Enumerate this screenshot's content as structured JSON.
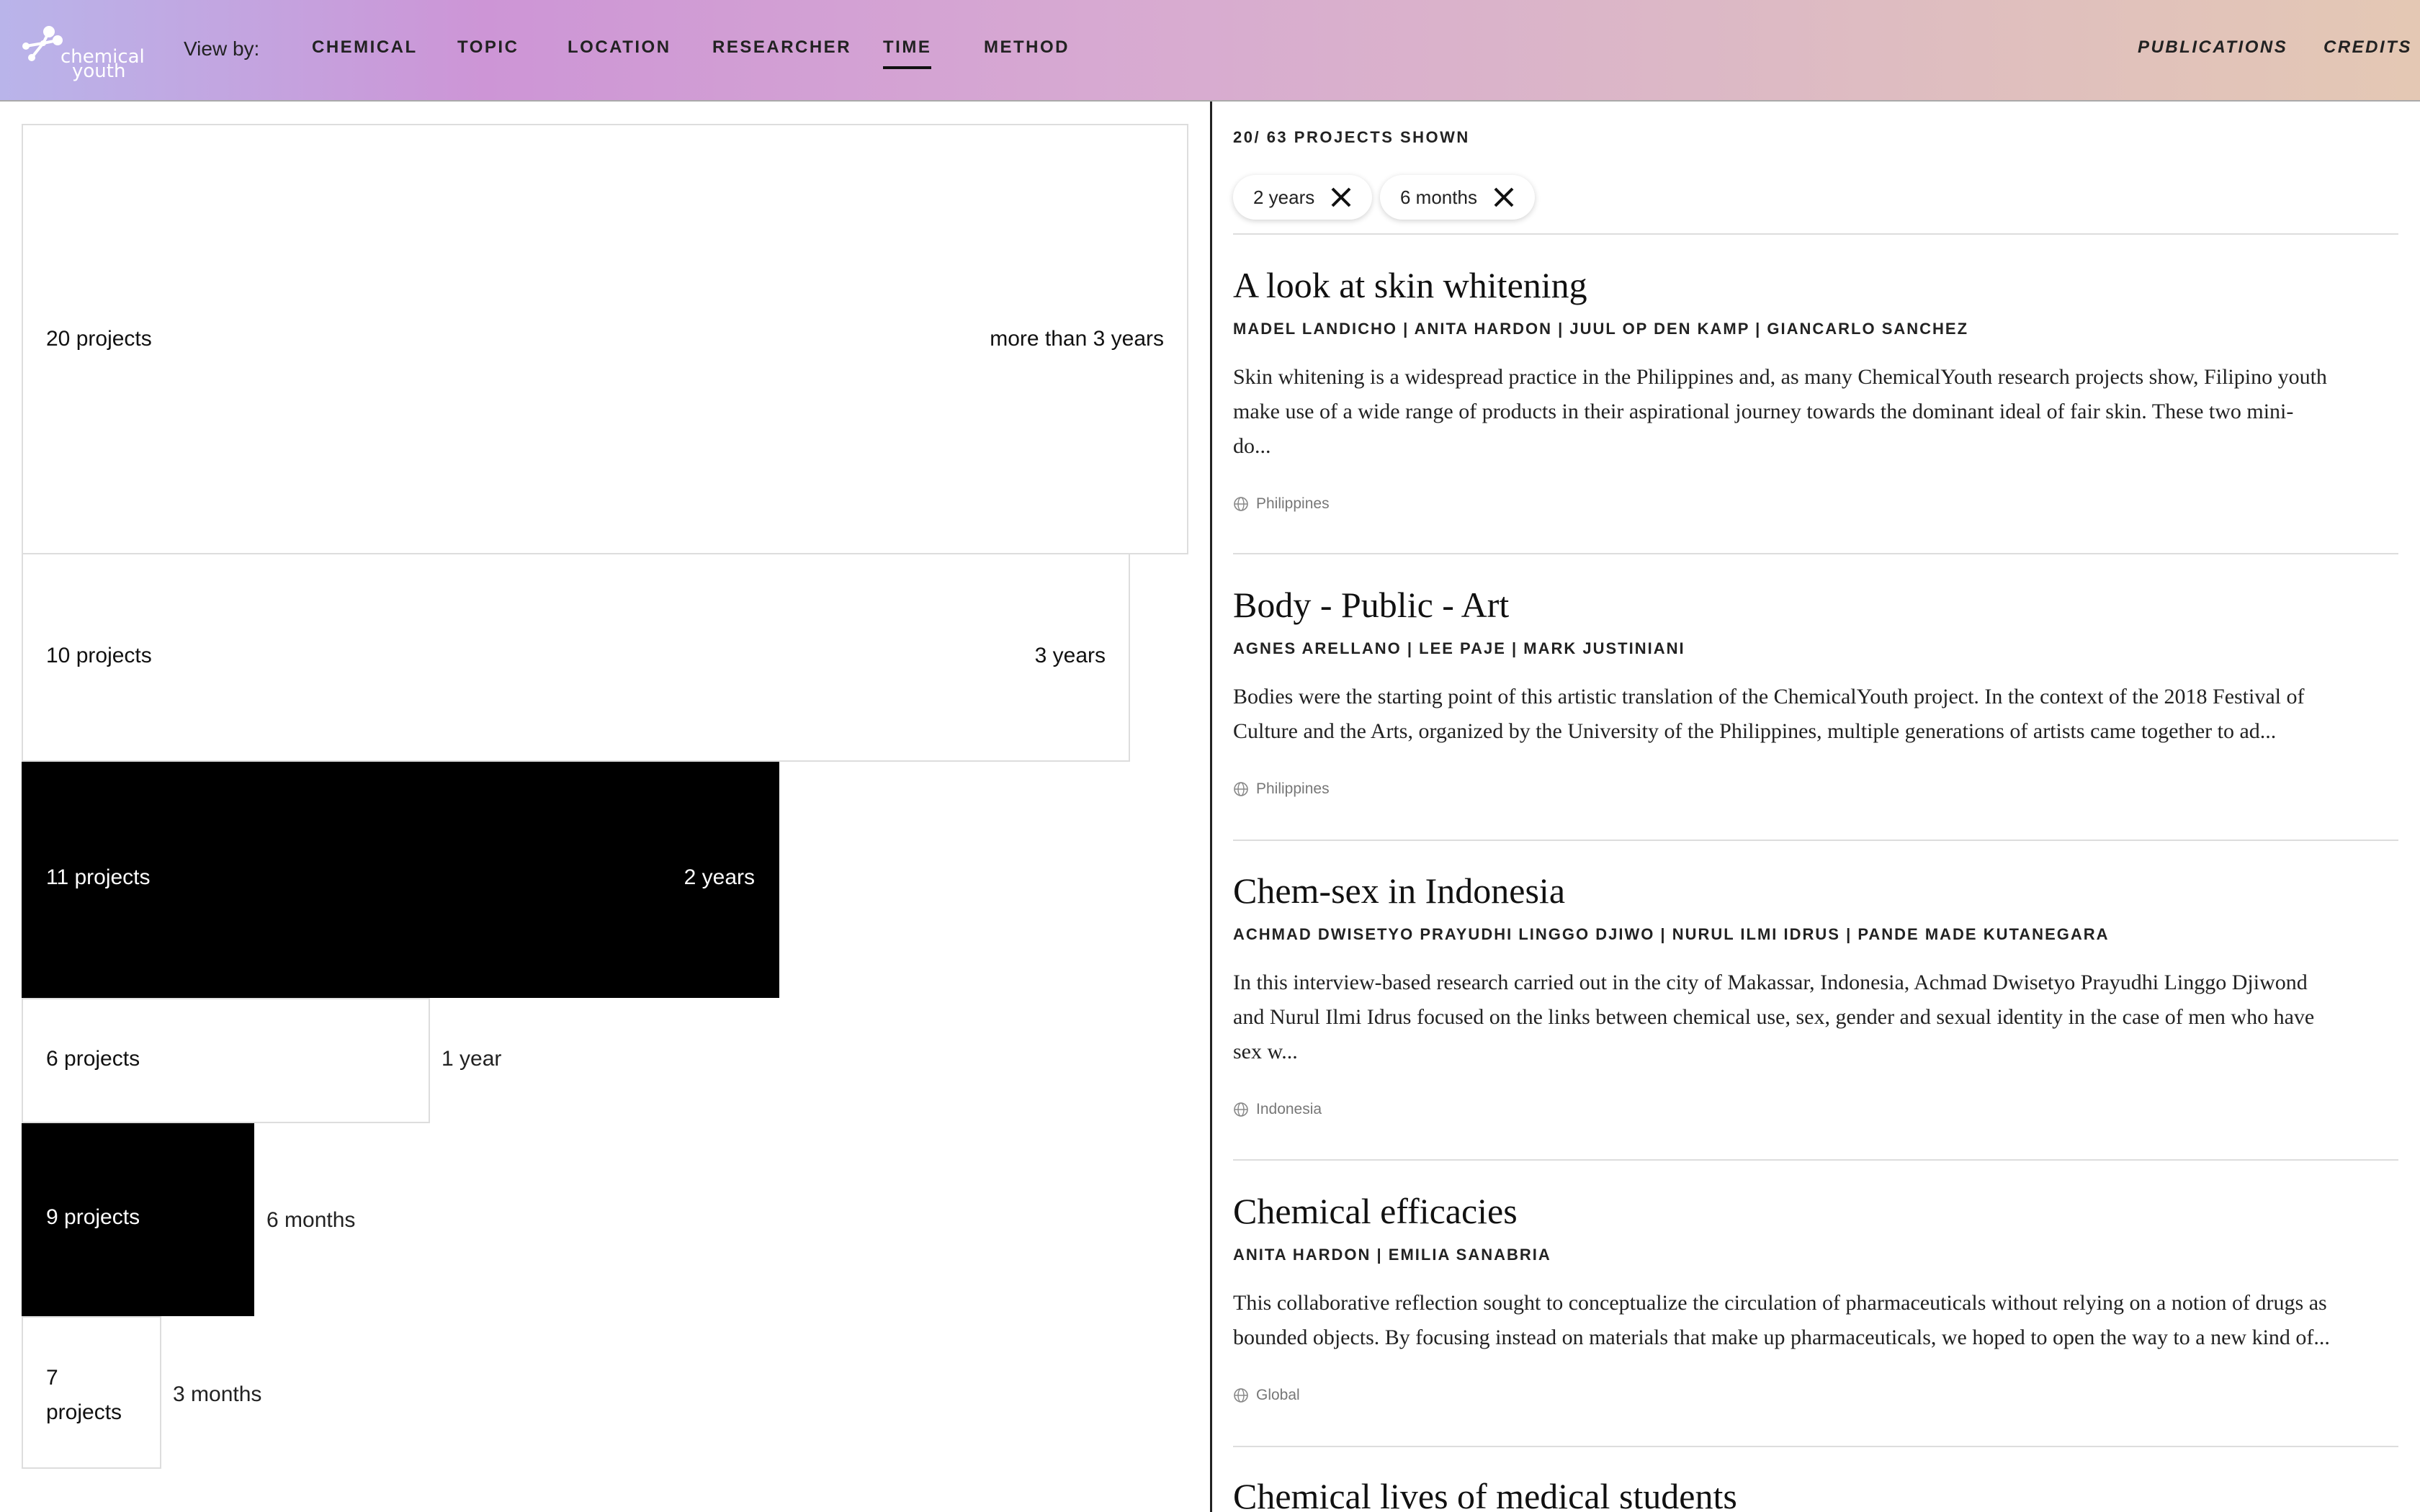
{
  "header": {
    "logo": {
      "line1": "chemical",
      "line2": "youth"
    },
    "view_by_label": "View by:",
    "nav": [
      "CHEMICAL",
      "TOPIC",
      "LOCATION",
      "RESEARCHER",
      "TIME",
      "METHOD"
    ],
    "active_nav": "TIME",
    "right_links": [
      "PUBLICATIONS",
      "CREDITS"
    ]
  },
  "duration_blocks": [
    {
      "count_label": "20 projects",
      "duration": "more than 3 years",
      "selected": false
    },
    {
      "count_label": "10 projects",
      "duration": "3 years",
      "selected": false
    },
    {
      "count_label": "11 projects",
      "duration": "2 years",
      "selected": true
    },
    {
      "count_label": "6 projects",
      "duration": "1 year",
      "selected": false
    },
    {
      "count_label": "9 projects",
      "duration": "6 months",
      "selected": true
    },
    {
      "count_label": "7 projects",
      "duration": "3 months",
      "selected": false
    }
  ],
  "results": {
    "shown_label": "20/ 63 PROJECTS SHOWN",
    "filters": [
      "2 years",
      "6 months"
    ]
  },
  "projects": [
    {
      "title": "A look at skin whitening",
      "authors": "MADEL LANDICHO | ANITA HARDON | JUUL OP DEN KAMP | GIANCARLO SANCHEZ",
      "desc_lines": [
        "Skin whitening is a widespread practice in the Philippines and, as many ChemicalYouth research projects show, Filipino youth",
        "make use of a wide range of products in their aspirational journey towards the dominant ideal of fair skin. These two mini-",
        "do..."
      ],
      "location": "Philippines"
    },
    {
      "title": "Body - Public - Art",
      "authors": "AGNES ARELLANO | LEE PAJE | MARK JUSTINIANI",
      "desc_lines": [
        "Bodies were the starting point of this artistic translation of the ChemicalYouth project. In the context of the 2018 Festival of",
        "Culture and the Arts, organized by the University of the Philippines, multiple generations of artists came together to ad..."
      ],
      "location": "Philippines"
    },
    {
      "title": "Chem-sex in Indonesia",
      "authors": "ACHMAD DWISETYO PRAYUDHI LINGGO DJIWO | NURUL ILMI IDRUS | PANDE MADE KUTANEGARA",
      "desc_lines": [
        "In this interview-based research carried out in the city of Makassar, Indonesia, Achmad Dwisetyo Prayudhi Linggo Djiwond",
        "and Nurul Ilmi Idrus focused on the links between chemical use, sex, gender and sexual identity in the case of men who have",
        "sex w..."
      ],
      "location": "Indonesia"
    },
    {
      "title": "Chemical efficacies",
      "authors": "ANITA HARDON | EMILIA SANABRIA",
      "desc_lines": [
        "This collaborative reflection sought to conceptualize the circulation of pharmaceuticals without relying on a notion of drugs as",
        "bounded objects. By focusing instead on materials that make up pharmaceuticals, we hoped to open the way to a new kind of..."
      ],
      "location": "Global"
    },
    {
      "title": "Chemical lives of medical students"
    }
  ]
}
